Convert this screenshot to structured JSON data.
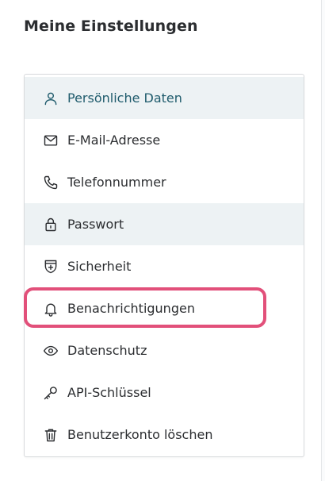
{
  "page": {
    "title": "Meine Einstellungen"
  },
  "menu": {
    "items": [
      {
        "label": "Persönliche Daten",
        "icon": "user-icon"
      },
      {
        "label": "E-Mail-Adresse",
        "icon": "mail-icon"
      },
      {
        "label": "Telefonnummer",
        "icon": "phone-icon"
      },
      {
        "label": "Passwort",
        "icon": "lock-icon"
      },
      {
        "label": "Sicherheit",
        "icon": "shield-icon"
      },
      {
        "label": "Benachrichtigungen",
        "icon": "bell-icon"
      },
      {
        "label": "Datenschutz",
        "icon": "eye-icon"
      },
      {
        "label": "API-Schlüssel",
        "icon": "key-icon"
      },
      {
        "label": "Benutzerkonto löschen",
        "icon": "trash-icon"
      }
    ],
    "active_item": "Persönliche Daten",
    "highlighted_item": "Benachrichtigungen"
  },
  "colors": {
    "active_text": "#1f5b6c",
    "shaded_row": "#edf2f4",
    "highlight_outline": "#e2507a"
  }
}
